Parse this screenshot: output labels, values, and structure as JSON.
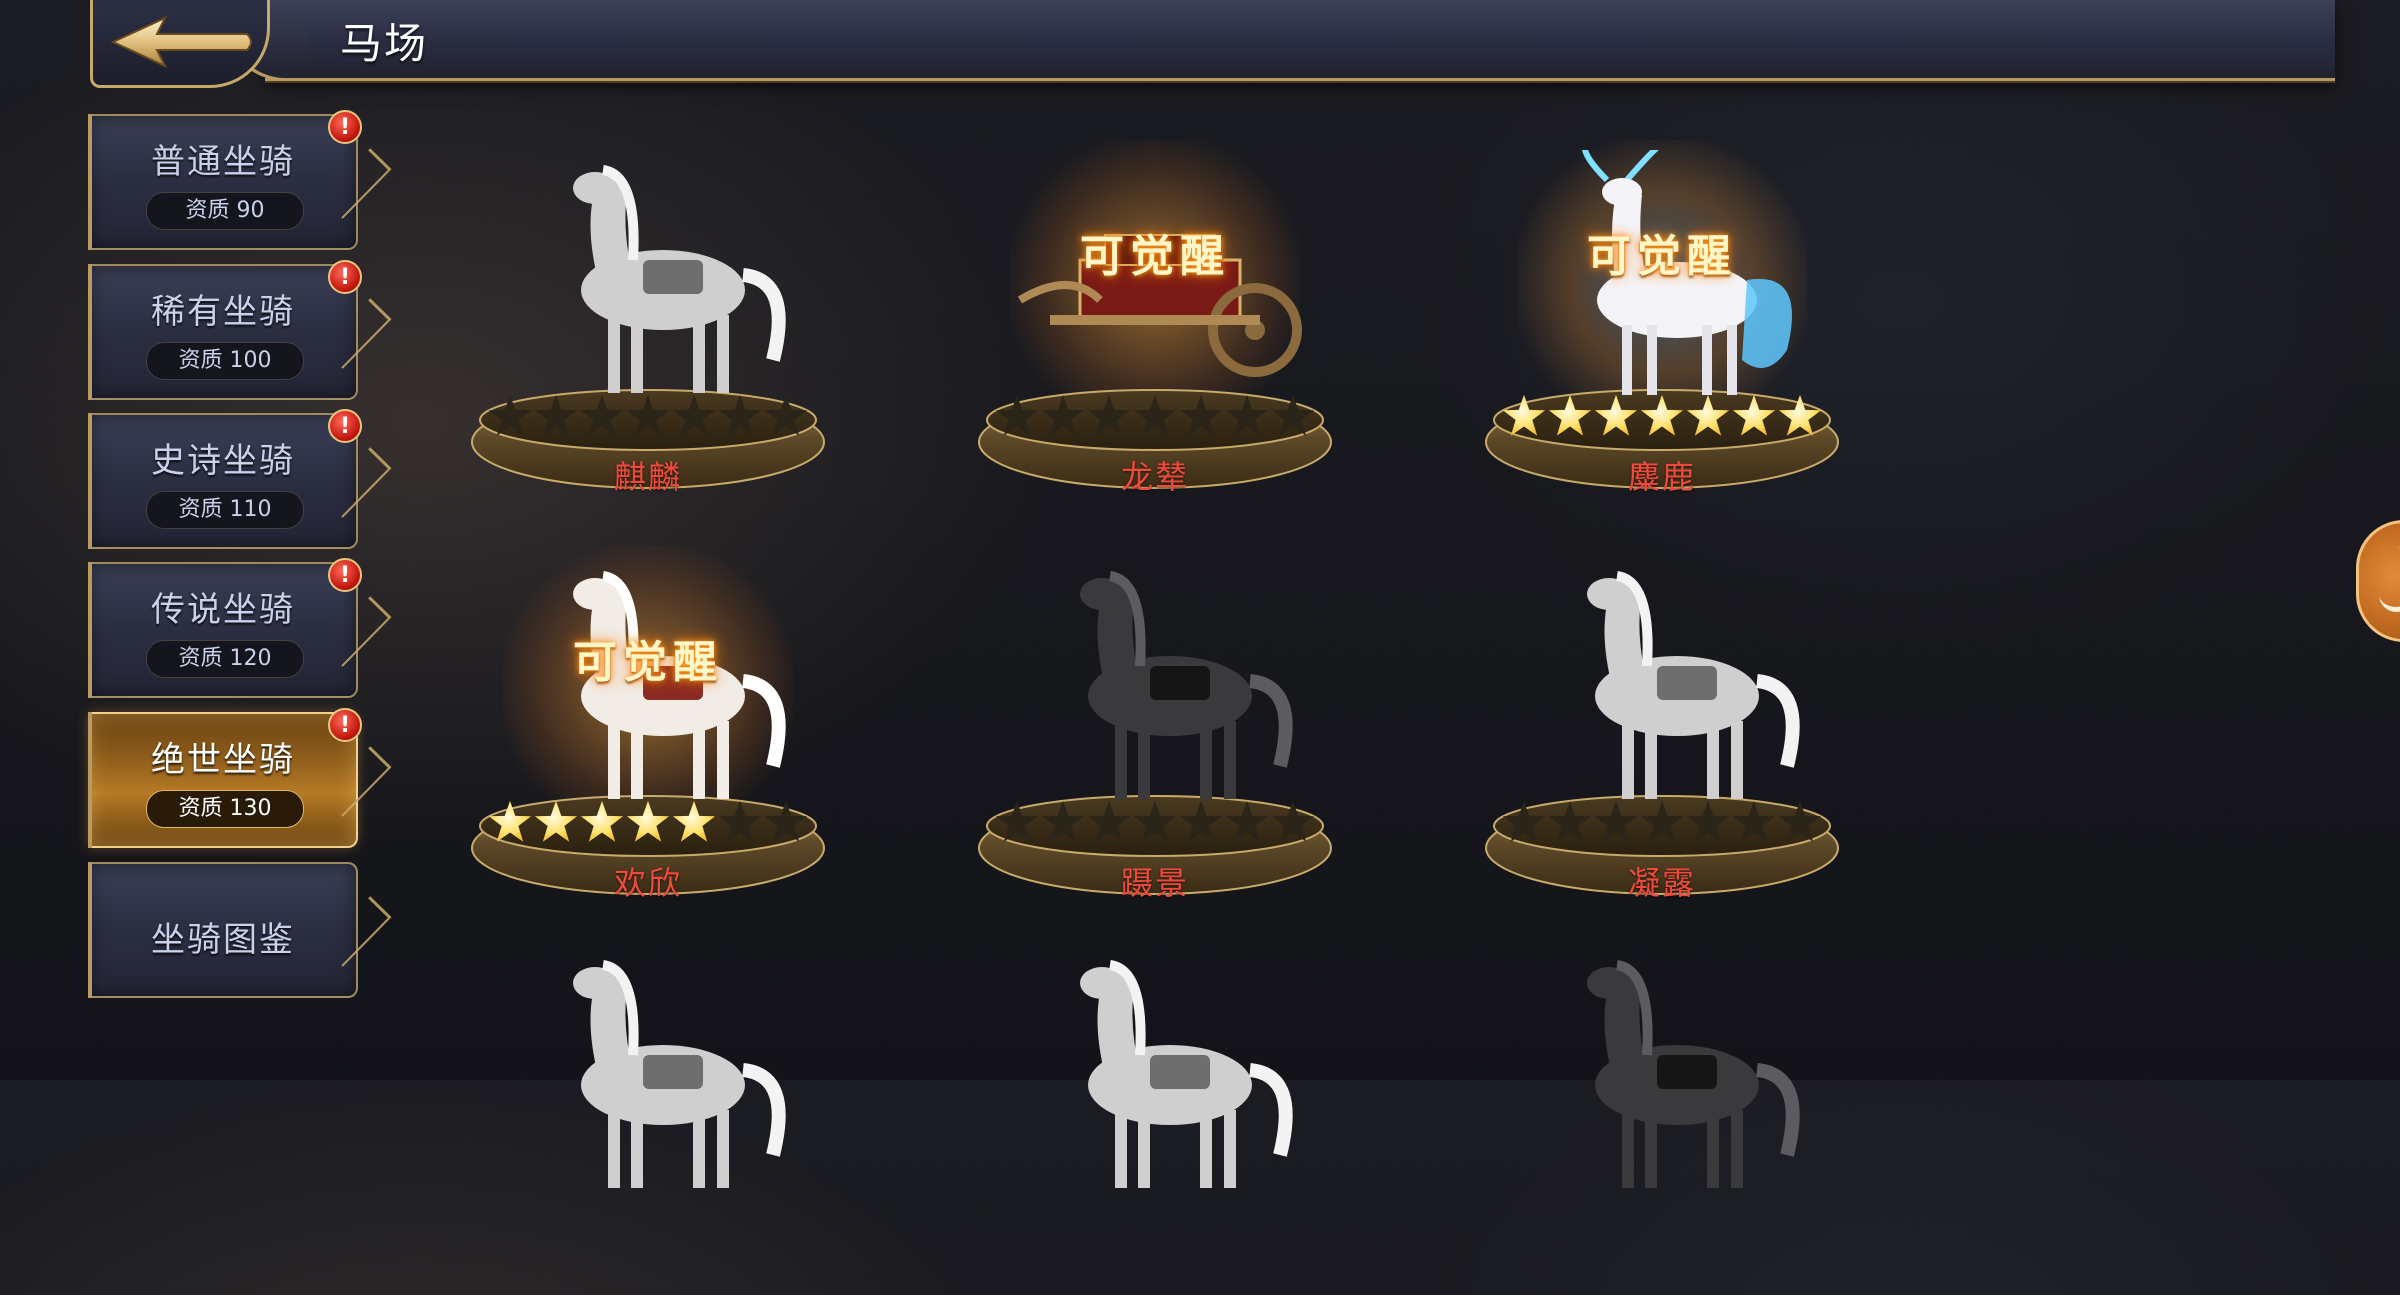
{
  "header": {
    "title": "马场",
    "back_icon": "arrow-left-icon"
  },
  "sidebar": {
    "items": [
      {
        "label": "普通坐骑",
        "quality": "资质 90",
        "alert": "!"
      },
      {
        "label": "稀有坐骑",
        "quality": "资质 100",
        "alert": "!"
      },
      {
        "label": "史诗坐骑",
        "quality": "资质 110",
        "alert": "!"
      },
      {
        "label": "传说坐骑",
        "quality": "资质 120",
        "alert": "!"
      },
      {
        "label": "绝世坐骑",
        "quality": "资质 130",
        "alert": "!",
        "selected": true
      },
      {
        "label": "坐骑图鉴"
      }
    ]
  },
  "mounts": [
    {
      "name": "麒麟",
      "stars": 0,
      "max_stars": 7,
      "awaken": "",
      "creature": "qilin",
      "color": "grey"
    },
    {
      "name": "龙辇",
      "stars": 0,
      "max_stars": 7,
      "awaken": "可觉醒",
      "creature": "chariot",
      "color": "color"
    },
    {
      "name": "麋鹿",
      "stars": 7,
      "max_stars": 7,
      "awaken": "可觉醒",
      "creature": "deer",
      "color": "color"
    },
    {
      "name": "欢欣",
      "stars": 5,
      "max_stars": 7,
      "awaken": "可觉醒",
      "creature": "horse",
      "color": "color"
    },
    {
      "name": "蹑景",
      "stars": 0,
      "max_stars": 7,
      "awaken": "",
      "creature": "horse",
      "color": "dark"
    },
    {
      "name": "凝露",
      "stars": 0,
      "max_stars": 7,
      "awaken": "",
      "creature": "horse",
      "color": "grey"
    },
    {
      "name": "",
      "creature": "horse",
      "color": "grey",
      "partial": true
    },
    {
      "name": "",
      "creature": "horse",
      "color": "grey",
      "partial": true
    },
    {
      "name": "",
      "creature": "horse",
      "color": "dark",
      "partial": true
    }
  ],
  "colors": {
    "name_red": "#f04a3c",
    "awaken_gold": "#fff6c8",
    "gold_border": "#c7a96a",
    "selected_tab": "#b57a25"
  },
  "side_widget_icon": "hand-icon"
}
